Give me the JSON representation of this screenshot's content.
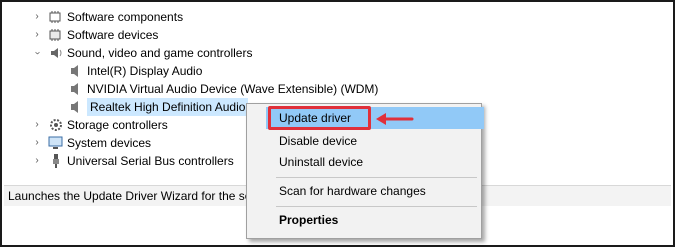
{
  "tree": {
    "items": [
      {
        "label": "Software components",
        "expanded": false
      },
      {
        "label": "Software devices",
        "expanded": false
      },
      {
        "label": "Sound, video and game controllers",
        "expanded": true
      },
      {
        "label": "Intel(R) Display Audio"
      },
      {
        "label": "NVIDIA Virtual Audio Device (Wave Extensible) (WDM)"
      },
      {
        "label": "Realtek High Definition Audio",
        "selected": true
      },
      {
        "label": "Storage controllers",
        "expanded": false
      },
      {
        "label": "System devices",
        "expanded": false
      },
      {
        "label": "Universal Serial Bus controllers",
        "expanded": false
      }
    ]
  },
  "status_bar": {
    "text": "Launches the Update Driver Wizard for the sele"
  },
  "context_menu": {
    "items": [
      {
        "label": "Update driver",
        "highlighted": true
      },
      {
        "label": "Disable device"
      },
      {
        "label": "Uninstall device"
      },
      {
        "label": "Scan for hardware changes"
      },
      {
        "label": "Properties",
        "bold": true
      }
    ]
  },
  "annotation": {
    "highlight_color": "#e0303a"
  },
  "colors": {
    "menu_highlight": "#91c9f7",
    "selection": "#cce8ff"
  }
}
